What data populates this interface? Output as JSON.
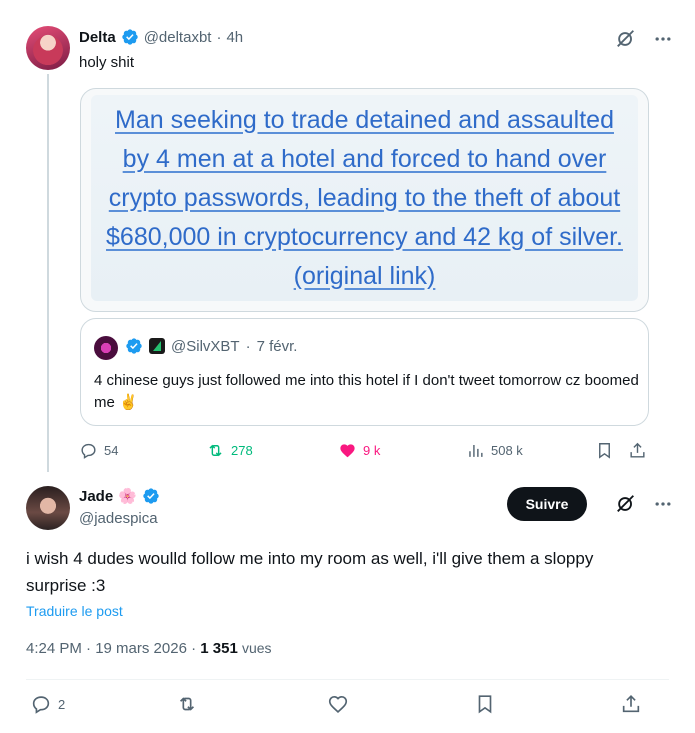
{
  "parent_tweet": {
    "display_name": "Delta",
    "handle": "@deltaxbt",
    "separator": "·",
    "time": "4h",
    "text": "holy shit",
    "media": {
      "headline": "Man seeking to trade detained and assaulted by 4 men at a hotel and forced to hand over crypto passwords, leading to the theft of about $680,000 in cryptocurrency and 42 kg of silver.",
      "link_text": "(original link)"
    },
    "quote": {
      "handle": "@SilvXBT",
      "separator": "·",
      "date": "7 févr.",
      "text": "4 chinese guys just followed me into this hotel if I don't tweet tomorrow cz boomed me ✌️"
    },
    "actions": {
      "replies": "54",
      "reposts": "278",
      "likes": "9 k",
      "views": "508 k"
    }
  },
  "main_tweet": {
    "display_name": "Jade",
    "name_emoji": "🌸",
    "handle": "@jadespica",
    "follow_label": "Suivre",
    "text": "i wish 4 dudes woulld follow me into my room as well, i'll give them a sloppy surprise :3",
    "translate_label": "Traduire le post",
    "timestamp": "4:24 PM · 19 mars 2026 · ",
    "views_count": "1 351",
    "views_label": "vues",
    "actions": {
      "replies": "2"
    }
  },
  "colors": {
    "verified": "#1d9bf0",
    "repost_active": "#00ba7c",
    "like_active": "#f91880",
    "link": "#1d9bf0",
    "text": "#0f1419",
    "muted": "#536471"
  }
}
